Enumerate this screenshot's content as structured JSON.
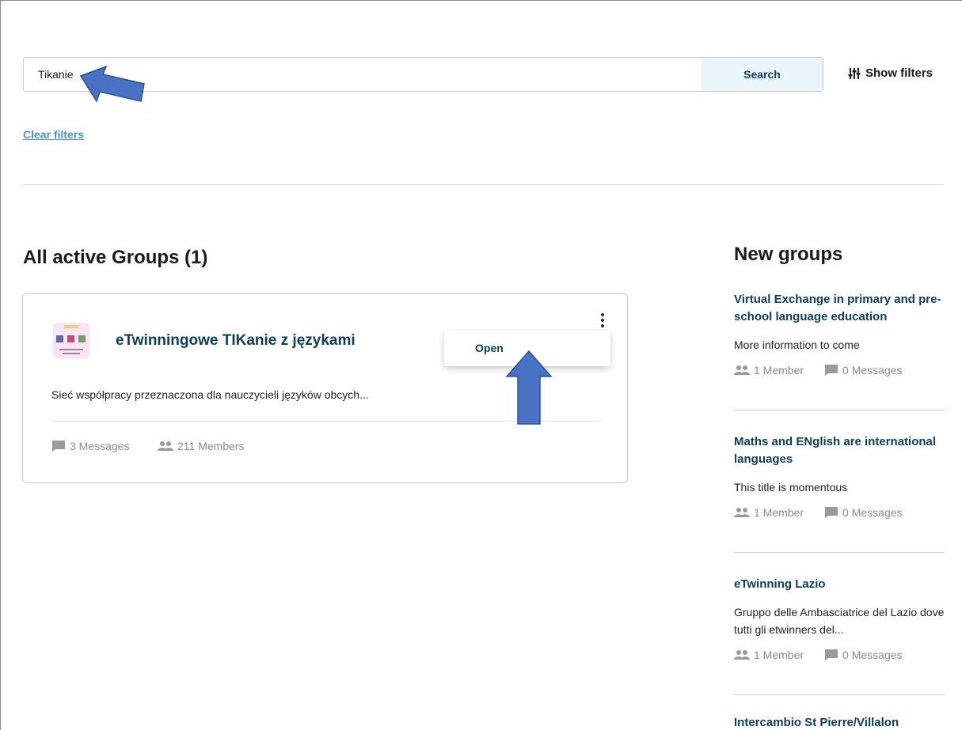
{
  "search": {
    "value": "Tikanie",
    "button_label": "Search",
    "show_filters_label": "Show filters",
    "clear_filters_label": "Clear filters"
  },
  "main": {
    "title": "All active Groups (1)",
    "groups": [
      {
        "title": "eTwinningowe TIKanie z językami",
        "description": "Sieć współpracy przeznaczona dla nauczycieli języków obcych...",
        "messages": "3 Messages",
        "members": "211 Members",
        "menu": {
          "open_label": "Open"
        }
      }
    ]
  },
  "sidebar": {
    "title": "New groups",
    "items": [
      {
        "title": "Virtual Exchange in primary and pre-school language education",
        "description": "More information to come",
        "members": "1 Member",
        "messages": "0 Messages"
      },
      {
        "title": "Maths and ENglish are international languages",
        "description": "This title is momentous",
        "members": "1 Member",
        "messages": "0 Messages"
      },
      {
        "title": "eTwinning Lazio",
        "description": "Gruppo delle Ambasciatrice del Lazio dove tutti gli etwinners del...",
        "members": "1 Member",
        "messages": "0 Messages"
      },
      {
        "title": "Intercambio St Pierre/Villalon"
      }
    ]
  },
  "icons": {
    "filter": "sliders-icon",
    "messages": "chat-bubble-icon",
    "members": "people-icon",
    "menu": "more-vertical-icon",
    "annotation": "arrow-annotation"
  },
  "colors": {
    "link_dark": "#0b3d5c",
    "link_light": "#4a90c9",
    "search_button_bg": "#eaf4fb",
    "arrow_fill": "#4a72c4",
    "arrow_stroke": "#2f4f8f",
    "muted": "#8a8a8a"
  }
}
